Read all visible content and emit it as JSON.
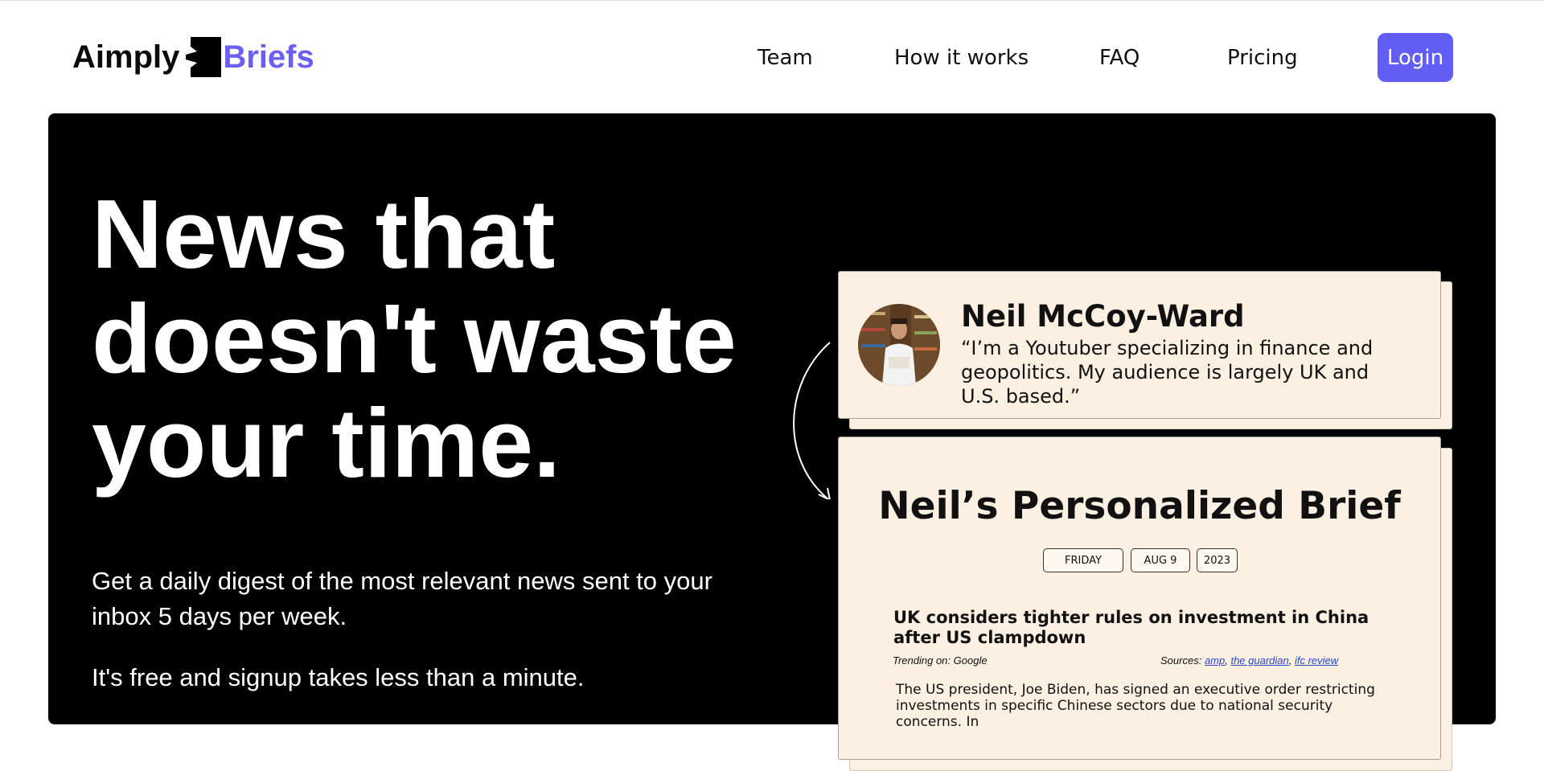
{
  "header": {
    "logo_word1": "Aimply",
    "logo_word2": "Briefs",
    "nav": [
      "Team",
      "How it works",
      "FAQ",
      "Pricing"
    ],
    "login_label": "Login"
  },
  "hero": {
    "headline": [
      "News that",
      "doesn't waste",
      "your time."
    ],
    "sub1": "Get a daily digest of the most relevant news sent to your inbox 5 days per week.",
    "sub2": "It's free and signup takes less than a minute."
  },
  "profile": {
    "name": "Neil McCoy-Ward",
    "quote": "“I’m a Youtuber specializing in finance and geopolitics. My audience is largely UK and U.S. based.”"
  },
  "brief": {
    "title": "Neil’s Personalized Brief",
    "date": {
      "day": "FRIDAY",
      "month_day": "AUG 9",
      "year": "2023"
    },
    "article": {
      "title": "UK considers tighter rules on investment in China after US clampdown",
      "trending_label": "Trending on: Google",
      "sources_label": "Sources:",
      "sources": [
        "amp",
        "the guardian",
        "ifc review"
      ],
      "body": "The US president, Joe Biden, has signed an executive order restricting investments in specific Chinese sectors due to national security concerns. In"
    }
  },
  "colors": {
    "accent": "#625df5",
    "brand_secondary": "#6a5ef5",
    "hero_bg": "#000000",
    "card_bg": "#fcf0e2",
    "link": "#2a46c8"
  },
  "icons": {
    "logo_mark": "folded-page-logo-icon",
    "arrow": "curved-arrow-icon"
  }
}
